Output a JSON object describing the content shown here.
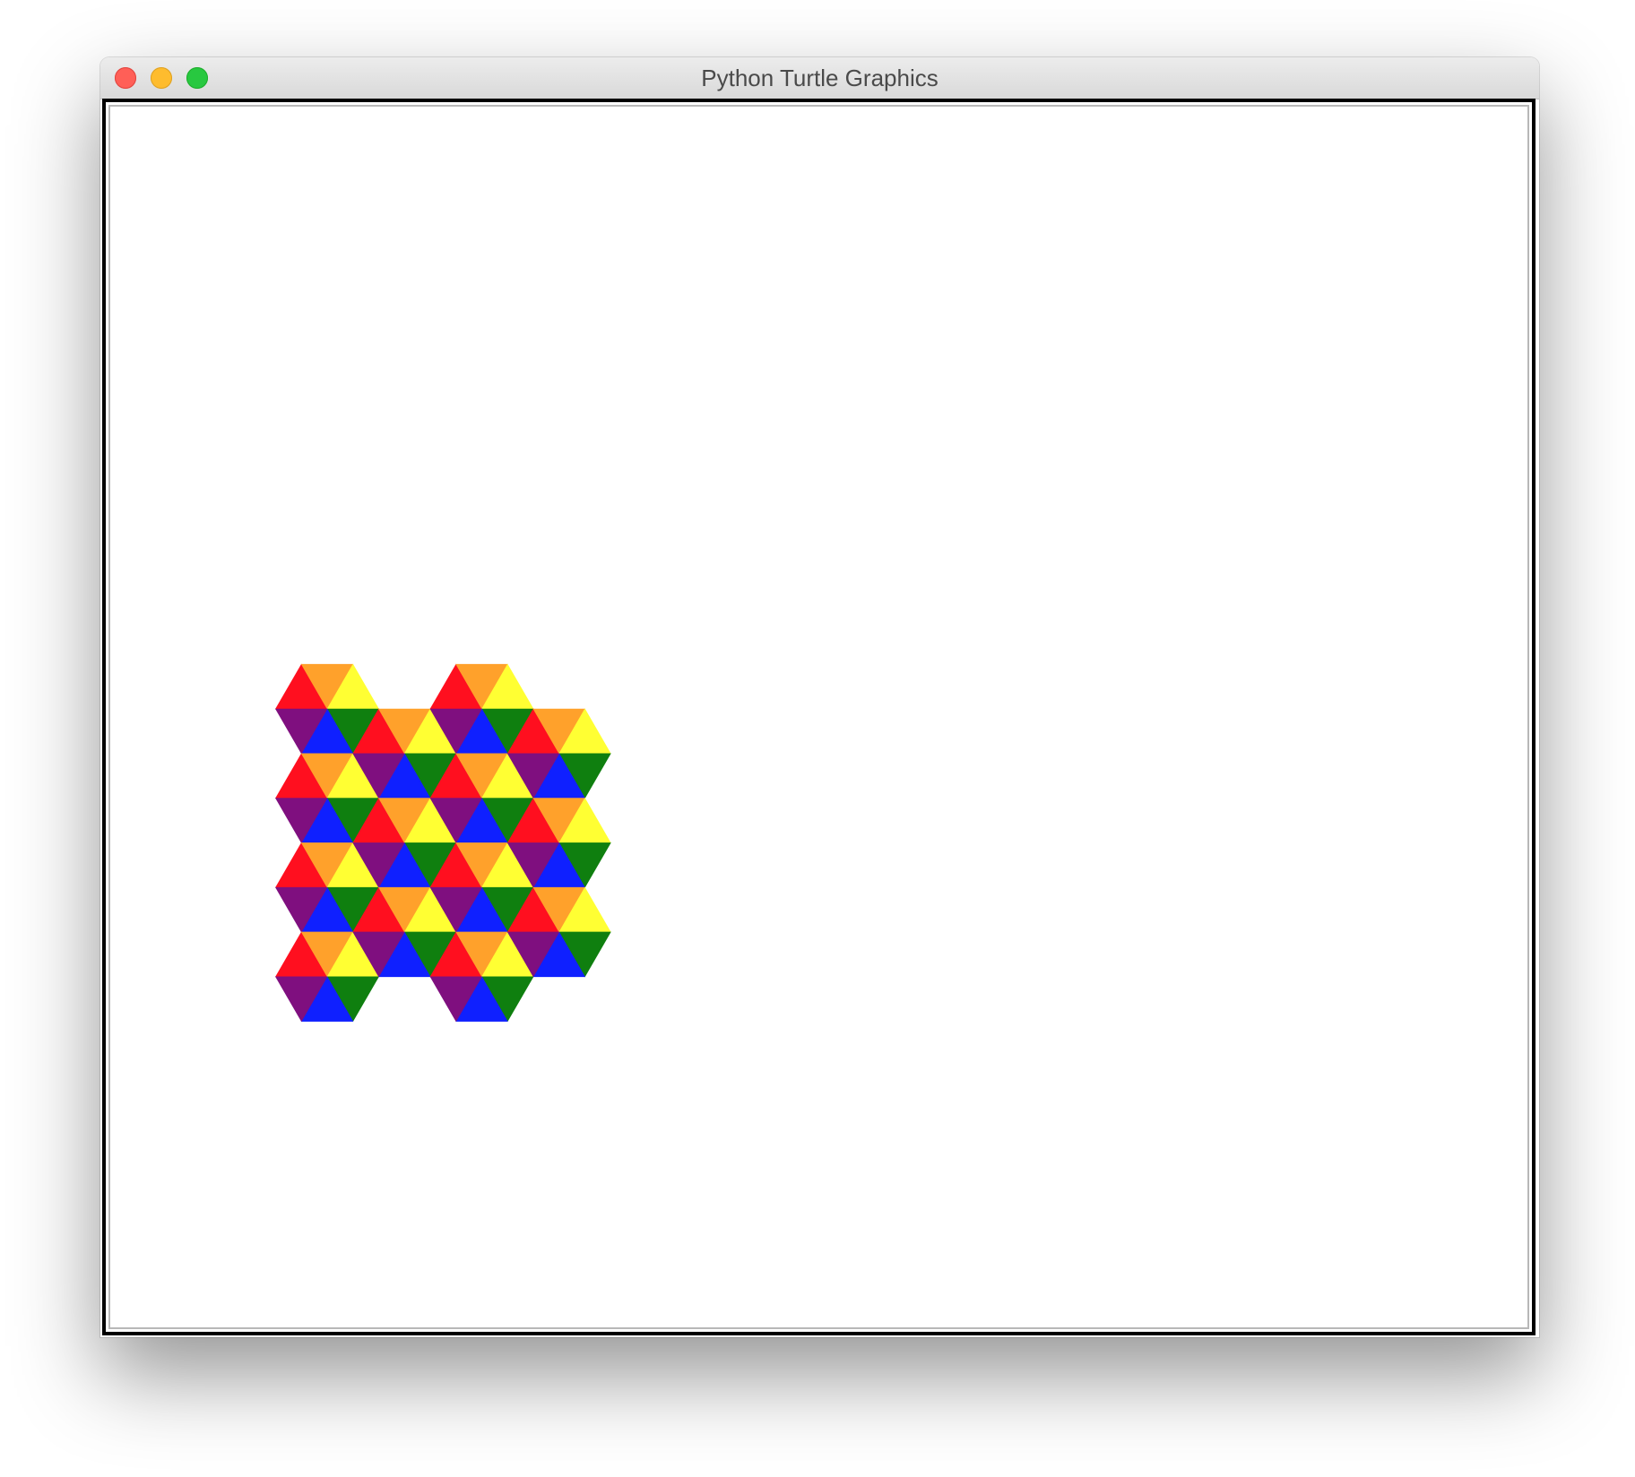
{
  "window": {
    "title": "Python Turtle Graphics"
  },
  "controls": {
    "close": "close-button",
    "minimize": "minimize-button",
    "zoom": "zoom-button"
  },
  "drawing": {
    "shape": "hexagon",
    "triangle_colors": {
      "top_left": "#ff0f1f",
      "top": "#ffa12b",
      "top_right": "#ffff33",
      "bottom_right": "#0f7f0f",
      "bottom": "#0f20ff",
      "bottom_left": "#7f0f7f"
    },
    "grid": {
      "columns": 4,
      "rows": [
        4,
        3,
        4,
        3
      ]
    }
  }
}
